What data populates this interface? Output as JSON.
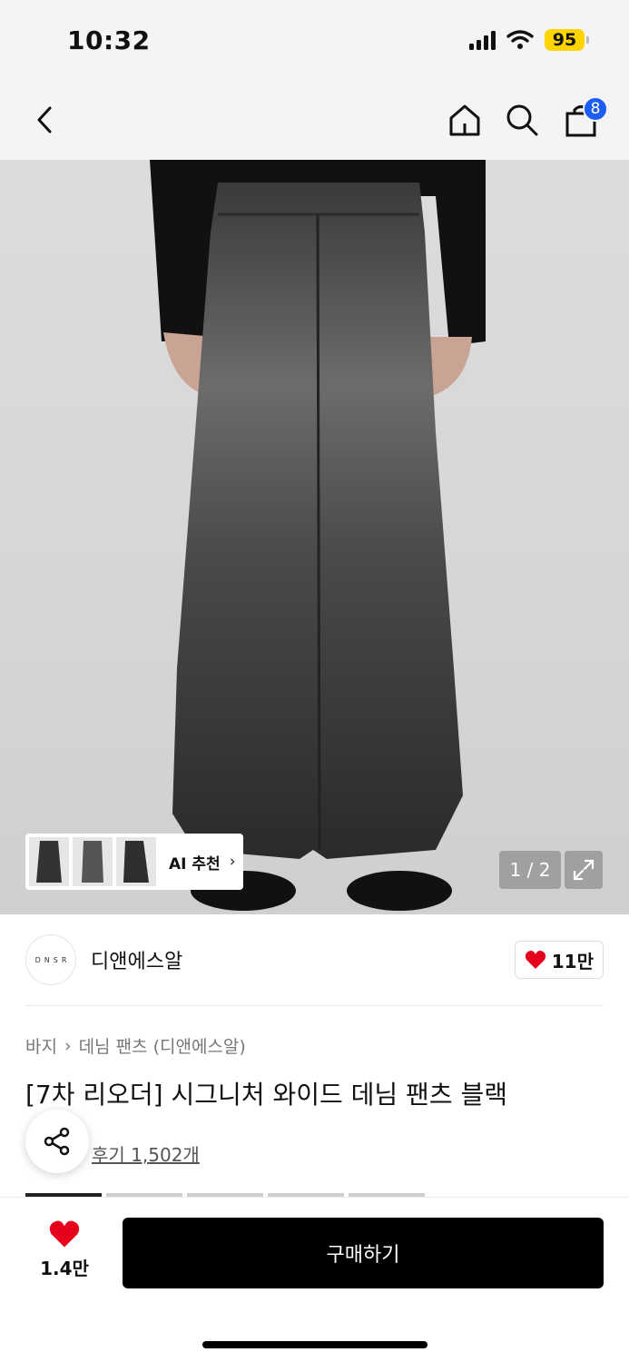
{
  "status_bar": {
    "time": "10:32",
    "battery": "95",
    "battery_color": "#ffd400"
  },
  "nav": {
    "back_icon": "chevron-left-icon",
    "home_icon": "home-icon",
    "search_icon": "search-icon",
    "cart_icon": "shopping-bag-icon",
    "cart_count": "8",
    "badge_color": "#1d5cf5"
  },
  "gallery": {
    "ai_label": "AI 추천",
    "pager": "1 / 2",
    "expand_icon": "expand-icon"
  },
  "brand": {
    "logo_text": "DNSR",
    "name": "디앤에스알",
    "likes": "11만",
    "heart_color": "#e5001c"
  },
  "breadcrumb": {
    "category": "바지",
    "subcategory": "데님 팬츠 (디앤에스알)"
  },
  "product": {
    "title": "[7차 리오더] 시그니처 와이드 데님 팬츠 블랙",
    "reviews": "후기 1,502개"
  },
  "bottom_bar": {
    "like_count": "1.4만",
    "buy_label": "구매하기"
  }
}
